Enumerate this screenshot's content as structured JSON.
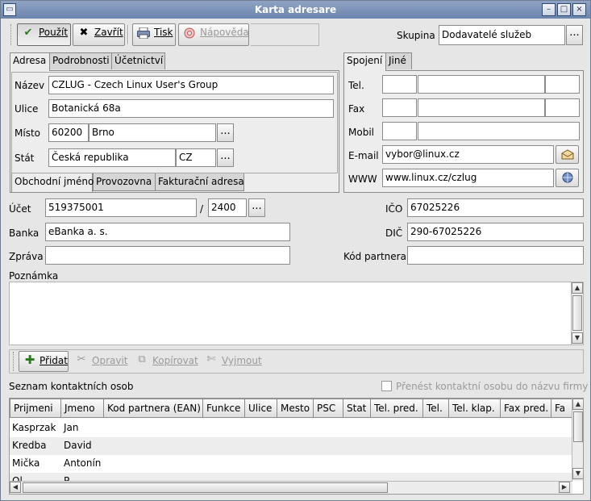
{
  "window": {
    "title": "Karta adresare",
    "controls": {
      "minimize": "–",
      "maximize": "□",
      "close": "×"
    }
  },
  "toolbar": {
    "apply": {
      "label": "Použít",
      "icon": "check-icon"
    },
    "close": {
      "label": "Zavřít",
      "icon": "x-icon"
    },
    "print": {
      "label": "Tisk",
      "icon": "printer-icon"
    },
    "help": {
      "label": "Nápověda",
      "icon": "help-buoy-icon"
    }
  },
  "group": {
    "label": "Skupina",
    "value": "Dodavatelé služeb",
    "button": "..."
  },
  "left_tabs": [
    "Adresa",
    "Podrobnosti",
    "Účetnictví"
  ],
  "address": {
    "name_label": "Název",
    "name_value": "CZLUG - Czech Linux User's Group",
    "street_label": "Ulice",
    "street_value": "Botanická 68a",
    "city_label": "Místo",
    "zip_value": "60200",
    "city_value": "Brno",
    "state_label": "Stát",
    "state_value": "Česká republika",
    "state_code": "CZ",
    "dots": "..."
  },
  "bottom_tabs": [
    "Obchodní jméno",
    "Provozovna",
    "Fakturační adresa"
  ],
  "right_tabs": [
    "Spojení",
    "Jiné"
  ],
  "contact": {
    "tel_label": "Tel.",
    "fax_label": "Fax",
    "mobile_label": "Mobil",
    "email_label": "E-mail",
    "email_value": "vybor@linux.cz",
    "www_label": "WWW",
    "www_value": "www.linux.cz/czlug"
  },
  "account": {
    "label": "Účet",
    "number": "519375001",
    "slash": "/",
    "bank_code": "2400",
    "button": "..."
  },
  "bank": {
    "label": "Banka",
    "value": "eBanka a. s."
  },
  "message": {
    "label": "Zpráva",
    "value": ""
  },
  "ico": {
    "label": "IČO",
    "value": "67025226"
  },
  "dic": {
    "label": "DIČ",
    "value": "290-67025226"
  },
  "partner_code": {
    "label": "Kód partnera",
    "value": ""
  },
  "note": {
    "label": "Poznámka",
    "value": ""
  },
  "contact_toolbar": {
    "add": {
      "label": "Přidat",
      "icon": "plus-icon"
    },
    "edit": {
      "label": "Opravit",
      "icon": "tools-icon"
    },
    "copy": {
      "label": "Kopírovat",
      "icon": "copy-icon"
    },
    "cut": {
      "label": "Vyjmout",
      "icon": "cut-icon"
    }
  },
  "contacts_section": {
    "label": "Seznam kontaktních osob",
    "transfer_checkbox_label": "Přenést kontaktní osobu do názvu firmy",
    "transfer_checked": false
  },
  "contacts_table": {
    "columns": [
      "Prijmeni",
      "Jmeno",
      "Kod partnera (EAN)",
      "Funkce",
      "Ulice",
      "Mesto",
      "PSC",
      "Stat",
      "Tel. pred.",
      "Tel.",
      "Tel. klap.",
      "Fax pred.",
      "Fa"
    ],
    "rows": [
      {
        "prijmeni": "Kasprzak",
        "jmeno": "Jan"
      },
      {
        "prijmeni": "Kredba",
        "jmeno": "David"
      },
      {
        "prijmeni": "Mička",
        "jmeno": "Antonín"
      },
      {
        "prijmeni": "Ol",
        "jmeno": "P"
      }
    ]
  },
  "colors": {
    "titlebar": "#7a90b6",
    "window_bg": "#e6e6e6",
    "row_alt": "#ededed"
  }
}
